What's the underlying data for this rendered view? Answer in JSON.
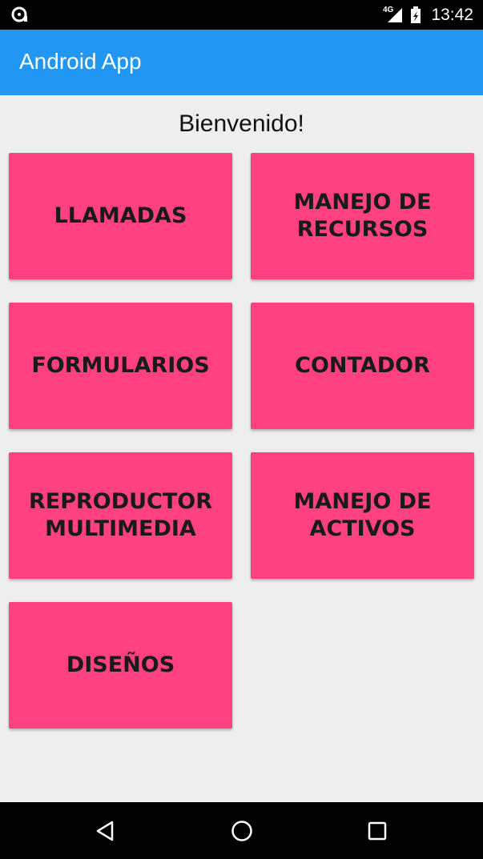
{
  "status_bar": {
    "network": "4G",
    "time": "13:42",
    "icons": [
      "sd-card-icon",
      "signal-icon",
      "battery-icon"
    ]
  },
  "app_bar": {
    "title": "Android App",
    "color": "#2196f3"
  },
  "main": {
    "welcome": "Bienvenido!",
    "tile_color": "#ff4081",
    "buttons": [
      {
        "label": "LLAMADAS"
      },
      {
        "label": "MANEJO DE\nRECURSOS"
      },
      {
        "label": "FORMULARIOS"
      },
      {
        "label": "CONTADOR"
      },
      {
        "label": "REPRODUCTOR\nMULTIMEDIA"
      },
      {
        "label": "MANEJO DE\nACTIVOS"
      },
      {
        "label": "DISEÑOS"
      }
    ]
  },
  "nav_bar": {
    "icons": [
      "back-icon",
      "home-icon",
      "recents-icon"
    ]
  }
}
